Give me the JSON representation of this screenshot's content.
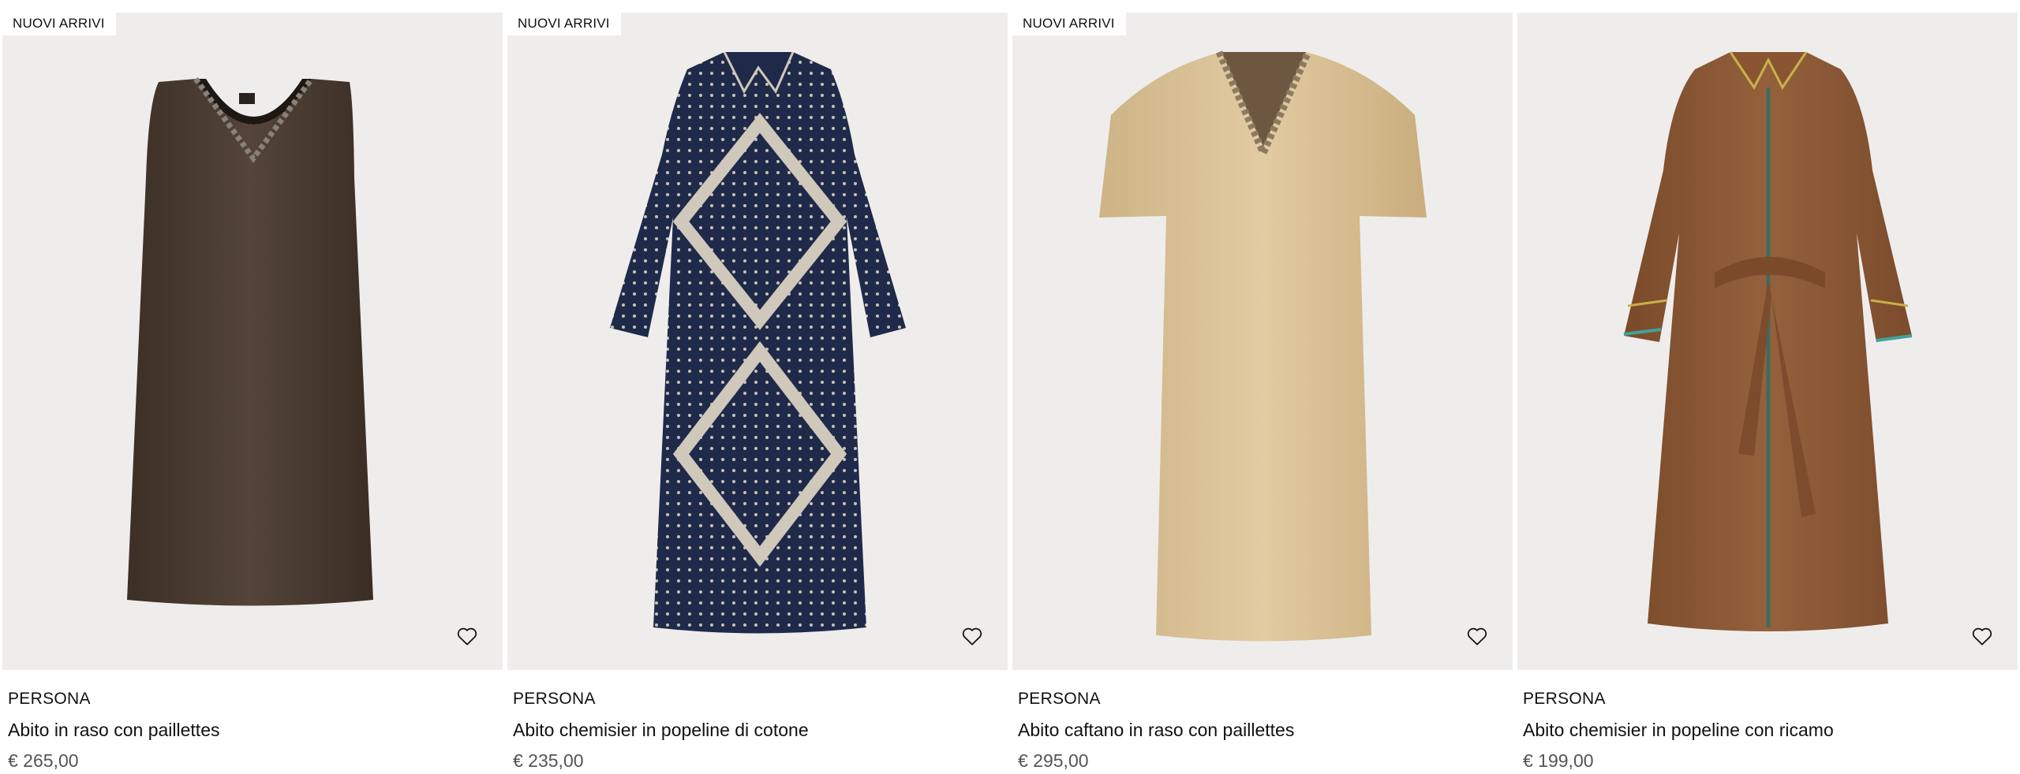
{
  "products": [
    {
      "badge": "NUOVI ARRIVI",
      "brand": "PERSONA",
      "title": "Abito in raso con paillettes",
      "price": "€ 265,00",
      "color": "#4a3a2e"
    },
    {
      "badge": "NUOVI ARRIVI",
      "brand": "PERSONA",
      "title": "Abito chemisier in popeline di cotone",
      "price": "€ 235,00",
      "color": "#1f2a4a"
    },
    {
      "badge": "NUOVI ARRIVI",
      "brand": "PERSONA",
      "title": "Abito caftano in raso con paillettes",
      "price": "€ 295,00",
      "color": "#d8bf94"
    },
    {
      "brand": "PERSONA",
      "title": "Abito chemisier in popeline con ricamo",
      "price": "€ 199,00",
      "color": "#8a5532"
    }
  ],
  "icons": {
    "wishlist": "heart-outline-icon"
  }
}
